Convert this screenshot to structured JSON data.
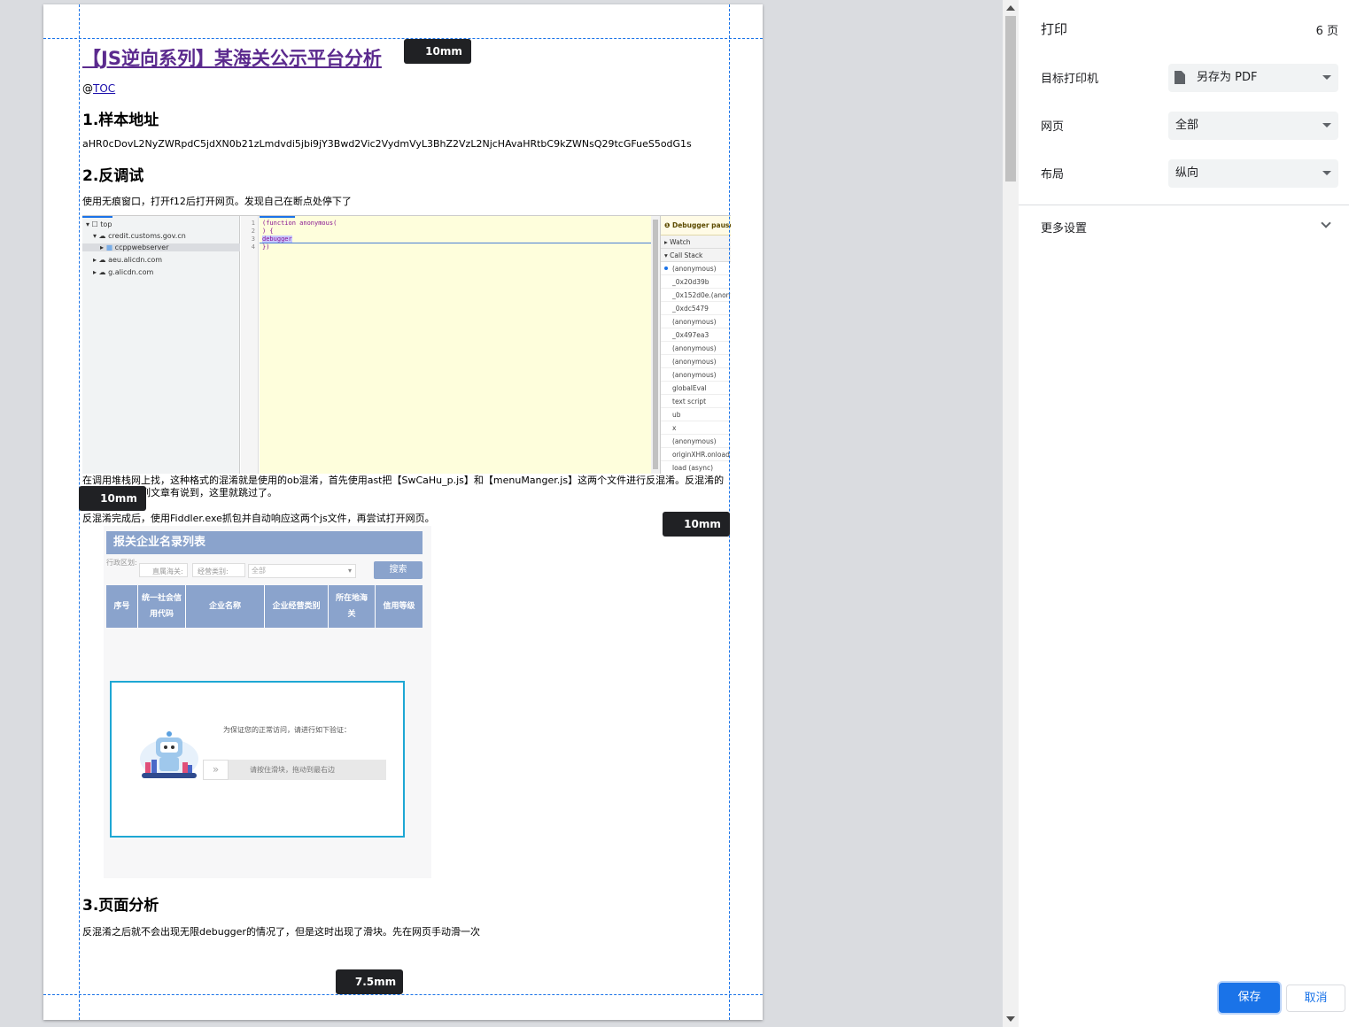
{
  "document": {
    "title": "【JS逆向系列】某海关公示平台分析",
    "toc_prefix": "@",
    "toc_link": "TOC",
    "sections": [
      {
        "heading": "1.样本地址",
        "text": "aHR0cDovL2NyZWRpdC5jdXN0b21zLmdvdi5jbi9jY3Bwd2Vic2VydmVyL3BhZ2VzL2NjcHAvaHRtbC9kZWNsQ29tcGFueS5odG1s"
      },
      {
        "heading": "2.反调试",
        "text": "使用无痕窗口，打开f12后打开网页。发现自己在断点处停下了"
      },
      {
        "heading": "3.页面分析",
        "text": "反混淆之后就不会出现无限debugger的情况了，但是这时出现了滑块。先在网页手动滑一次"
      }
    ],
    "para_ob": "在调用堆栈网上找，这种格式的混淆就是使用的ob混淆，首先使用ast把【SwCaHu_p.js】和【menuManger.js】这两个文件进行反混淆。反混淆的方法在之前系列文章有说到，这里就跳过了。",
    "para_fiddler": "反混淆完成后，使用Fiddler.exe抓包并自动响应这两个js文件，再尝试打开网页。"
  },
  "margins": {
    "top": "10mm",
    "left": "10mm",
    "right": "10mm",
    "bottom": "7.5mm"
  },
  "devtools": {
    "tree": [
      "top",
      "credit.customs.gov.cn",
      "ccppwebserver",
      "aeu.alicdn.com",
      "g.alicdn.com"
    ],
    "line_numbers": [
      "1",
      "2",
      "3",
      "4"
    ],
    "code_lines": [
      "(function anonymous(",
      ") {",
      "debugger",
      "})"
    ],
    "paused_label": "Debugger paused",
    "watch_label": "Watch",
    "callstack_label": "Call Stack",
    "callstack": [
      "(anonymous)",
      "_0x20d39b",
      "_0x152d0e.(anonymous)",
      "_0xdc5479",
      "(anonymous)",
      "_0x497ea3",
      "(anonymous)",
      "(anonymous)",
      "(anonymous)",
      "globalEval",
      "text script",
      "ub",
      "x",
      "(anonymous)",
      "originXHR.onload",
      "load (async)"
    ]
  },
  "customs": {
    "banner": "报关企业名录列表",
    "filter_region_label": "行政区划:",
    "filter_customs_label": "直属海关:",
    "filter_type_label": "经营类别:",
    "filter_type_value": "全部",
    "search_button": "搜索",
    "columns": [
      "序号",
      "统一社会信用代码",
      "企业名称",
      "企业经营类别",
      "所在地海关",
      "信用等级"
    ],
    "captcha_message": "为保证您的正常访问，请进行如下验证：",
    "slider_hint": "请按住滑块，拖动到最右边",
    "slider_knob": "»"
  },
  "print_panel": {
    "title": "打印",
    "page_count": "6 页",
    "printer_label": "目标打印机",
    "printer_value": "另存为 PDF",
    "pages_label": "网页",
    "pages_value": "全部",
    "layout_label": "布局",
    "layout_value": "纵向",
    "more_settings": "更多设置",
    "save_button": "保存",
    "cancel_button": "取消"
  }
}
